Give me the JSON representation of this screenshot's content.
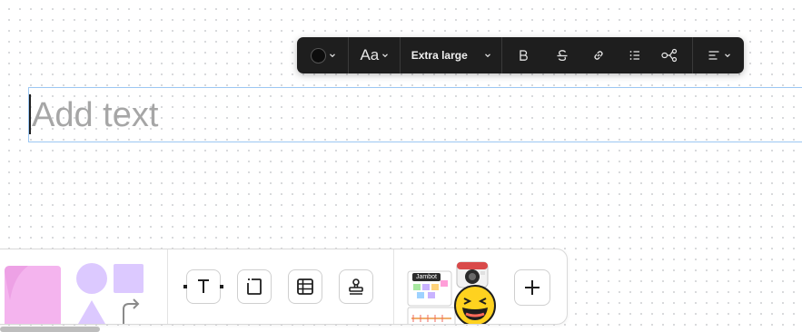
{
  "toolbar": {
    "text_color": "#0d0d0d",
    "font_label": "Aa",
    "size_label": "Extra large",
    "icons": [
      "text-color-swatch",
      "font-icon",
      "bold-icon",
      "strikethrough-icon",
      "link-icon",
      "bullet-list-icon",
      "mindmap-icon",
      "align-icon"
    ]
  },
  "textbox": {
    "placeholder": "Add text",
    "border_color": "#9cc7f3"
  },
  "bottom_bar": {
    "tools": [
      "text-tool",
      "frame-tool",
      "table-tool",
      "stamp-tool"
    ],
    "widget_label": "Jambot",
    "add_button": "add-icon"
  },
  "colors": {
    "toolbar_bg": "#1e1e1e",
    "sticky": "#f4b4ee",
    "shapes": "#d9c9ff"
  }
}
